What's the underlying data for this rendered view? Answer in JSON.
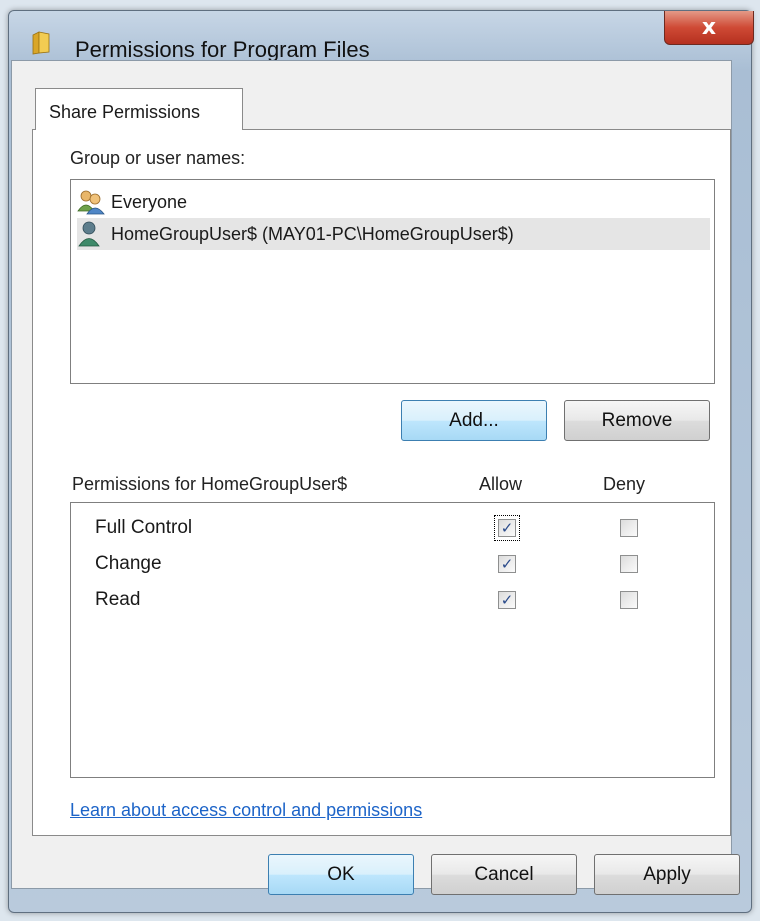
{
  "window": {
    "title": "Permissions for Program Files",
    "close_glyph": "x"
  },
  "tabs": [
    {
      "label": "Share Permissions"
    }
  ],
  "group_section": {
    "label": "Group or user names:",
    "items": [
      {
        "name": "Everyone",
        "icon": "users-group-icon",
        "selected": false
      },
      {
        "name": "HomeGroupUser$ (MAY01-PC\\HomeGroupUser$)",
        "icon": "user-icon",
        "selected": true
      }
    ],
    "add_label": "Add...",
    "remove_label": "Remove"
  },
  "permissions": {
    "header": "Permissions for HomeGroupUser$",
    "allow_header": "Allow",
    "deny_header": "Deny",
    "rows": [
      {
        "name": "Full Control",
        "allow": true,
        "deny": false
      },
      {
        "name": "Change",
        "allow": true,
        "deny": false
      },
      {
        "name": "Read",
        "allow": true,
        "deny": false
      }
    ]
  },
  "help_link": "Learn about access control and permissions",
  "footer": {
    "ok_label": "OK",
    "cancel_label": "Cancel",
    "apply_label": "Apply"
  }
}
